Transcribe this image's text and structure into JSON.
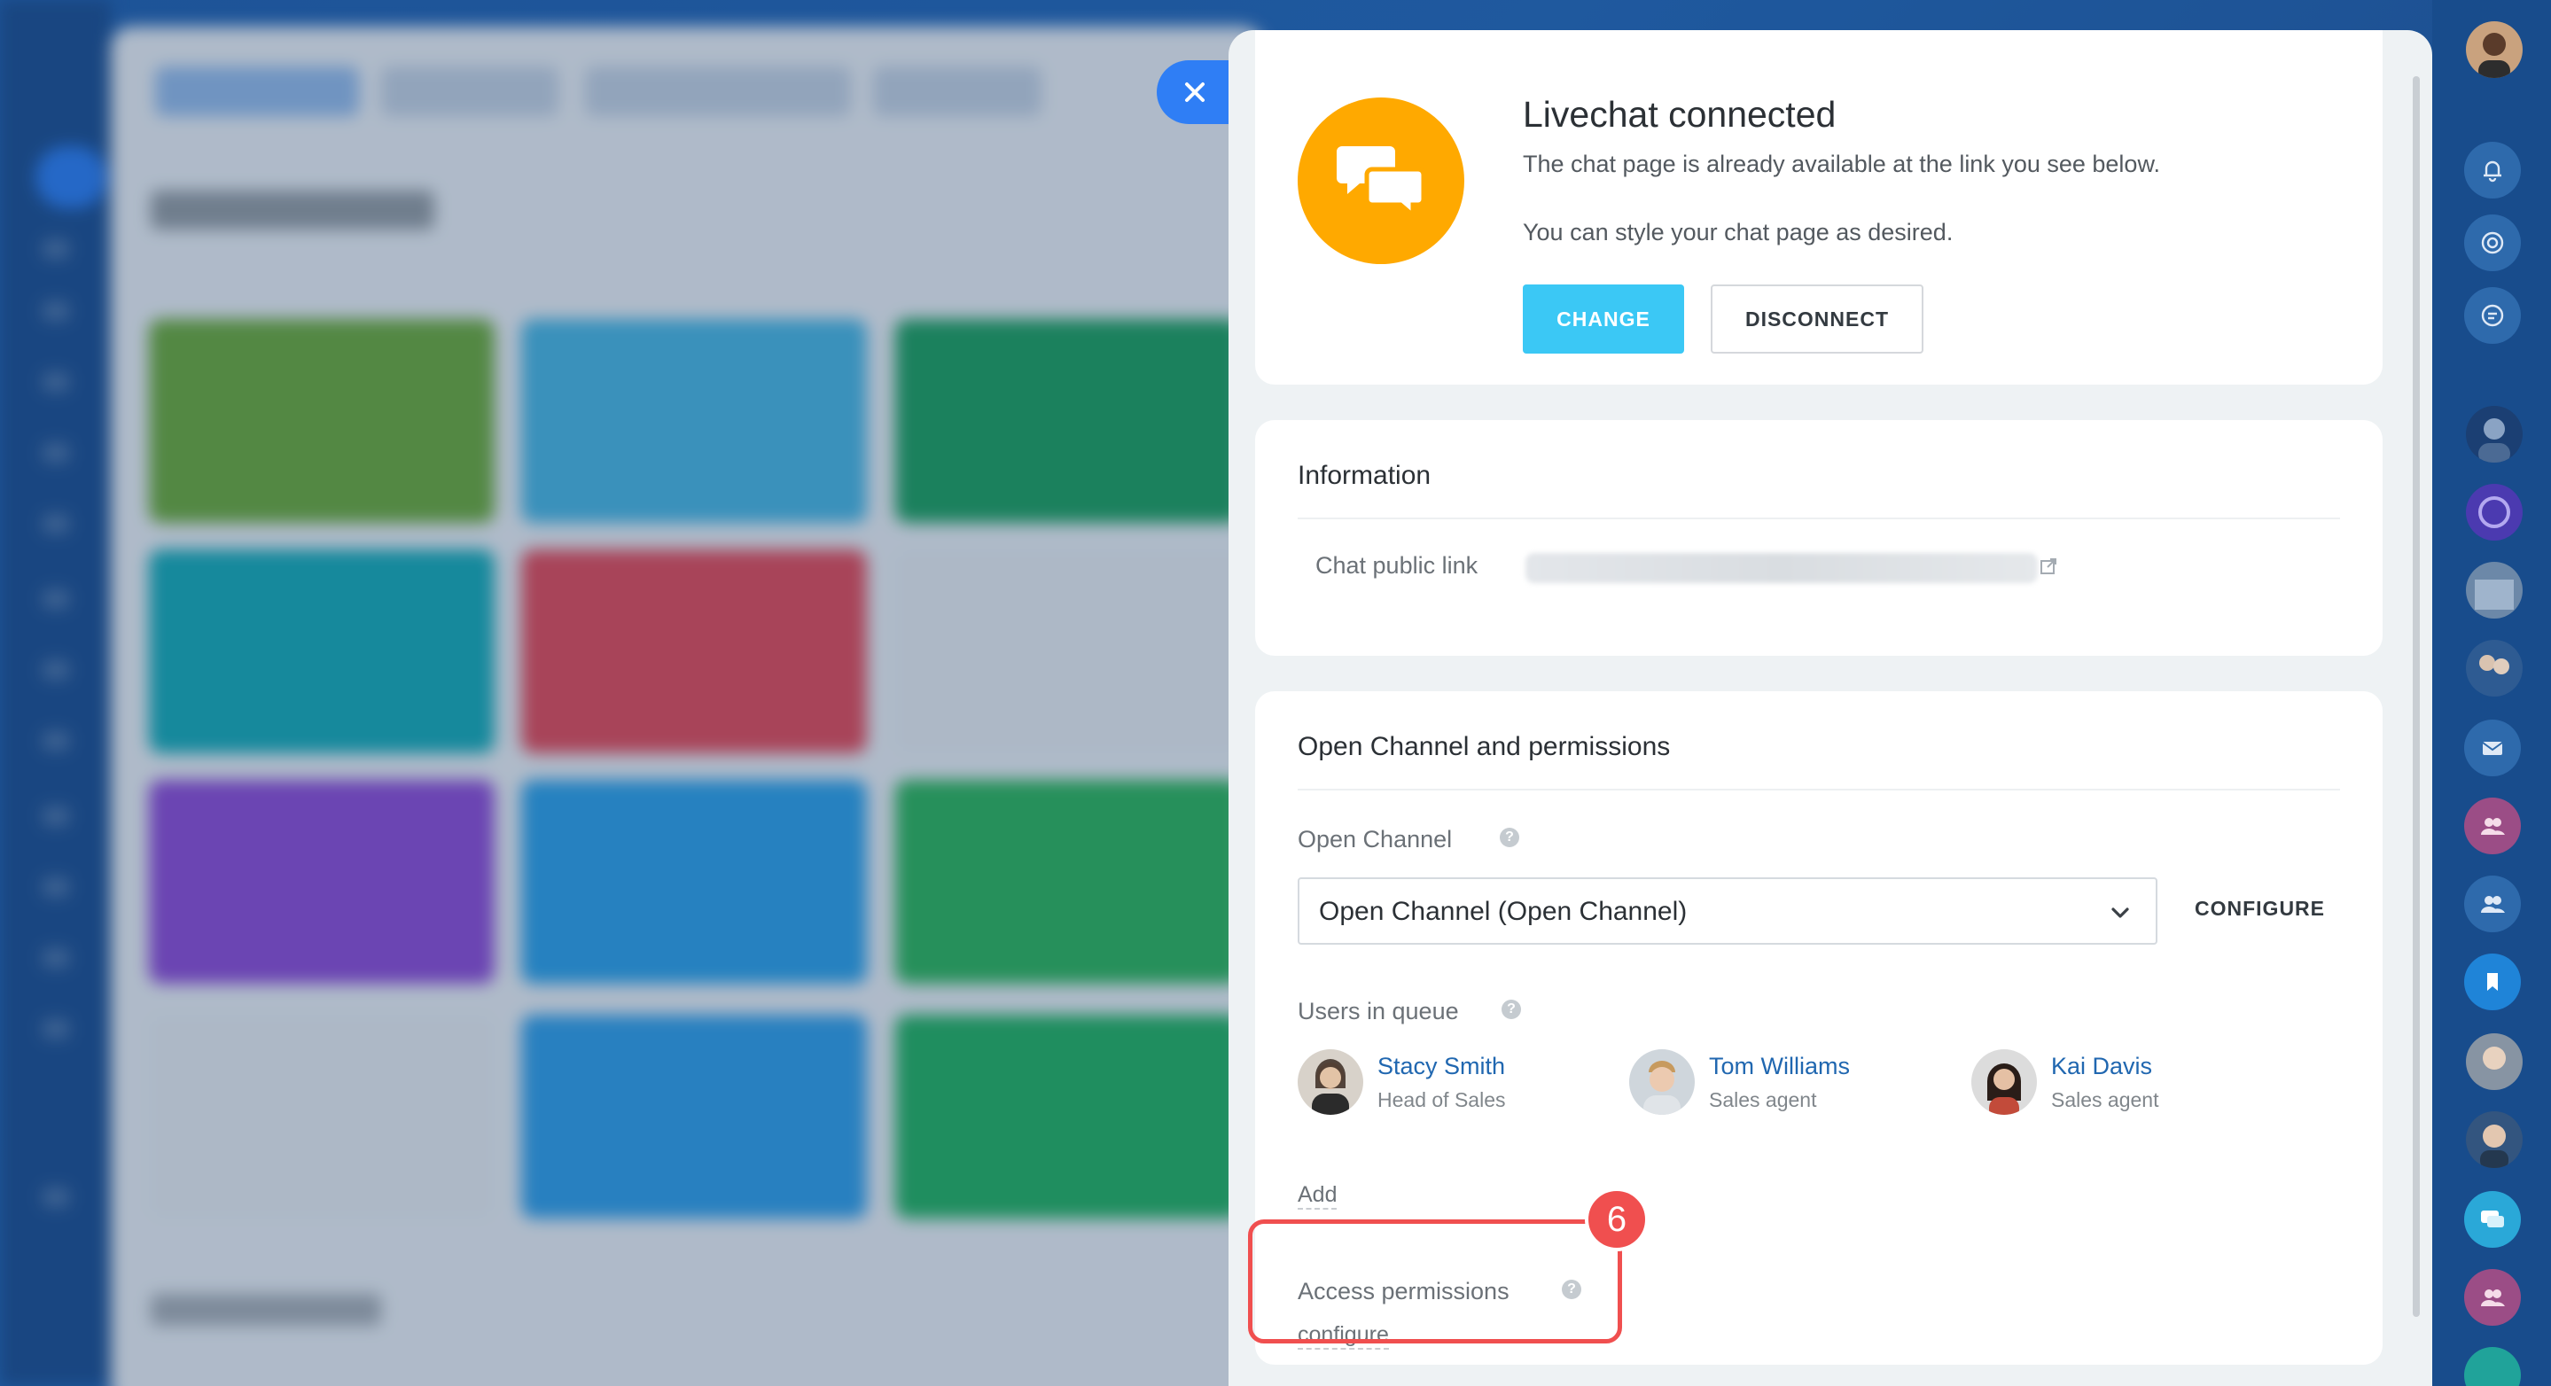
{
  "close": {
    "icon": "close-icon"
  },
  "livechat": {
    "title": "Livechat connected",
    "desc1": "The chat page is already available at the link you see below.",
    "desc2": "You can style your chat page as desired.",
    "change_label": "CHANGE",
    "disconnect_label": "DISCONNECT",
    "logo_icon": "chat-bubbles-icon",
    "accent": "#3bc8f5",
    "logo_color": "#ffa900"
  },
  "information": {
    "title": "Information",
    "public_link_label": "Chat public link",
    "public_link_value": ""
  },
  "open_channel": {
    "title": "Open Channel and permissions",
    "channel_label": "Open Channel",
    "channel_selected": "Open Channel (Open Channel)",
    "configure_label": "CONFIGURE",
    "users_label": "Users in queue",
    "users": [
      {
        "name": "Stacy Smith",
        "role": "Head of Sales"
      },
      {
        "name": "Tom Williams",
        "role": "Sales agent"
      },
      {
        "name": "Kai Davis",
        "role": "Sales agent"
      }
    ],
    "add_label": "Add",
    "access_label": "Access permissions",
    "access_configure": "configure",
    "link_color": "#2067b0"
  },
  "annotation": {
    "step": "6",
    "color": "#f04f4f"
  },
  "rail": {
    "icons": [
      "bell-icon",
      "target-icon",
      "chat-sync-icon",
      "mail-icon",
      "group-icon",
      "group-icon",
      "bookmark-icon",
      "chat-icon",
      "group-icon"
    ]
  }
}
